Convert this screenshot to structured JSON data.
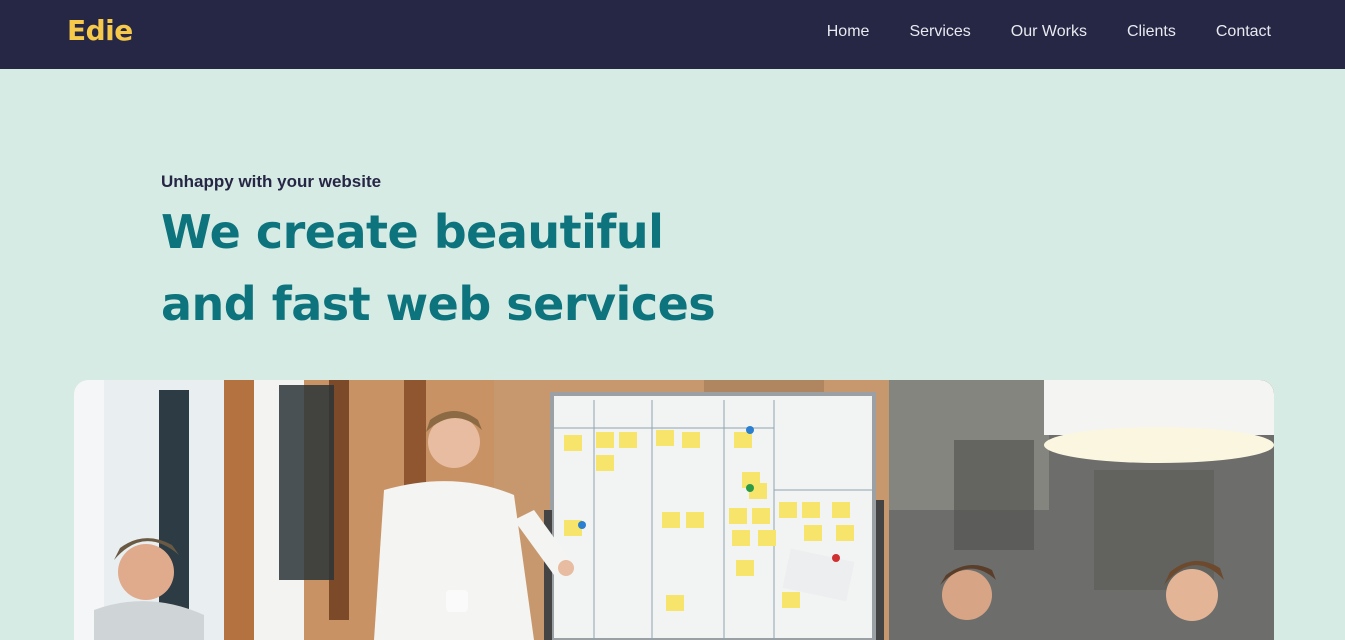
{
  "header": {
    "logo": "Edie",
    "nav": [
      "Home",
      "Services",
      "Our Works",
      "Clients",
      "Contact"
    ]
  },
  "hero": {
    "kicker": "Unhappy with your website",
    "title_line1": "We create beautiful",
    "title_line2": "and fast web services",
    "image_alt": "team-meeting-photo"
  },
  "colors": {
    "nav_bg": "#262645",
    "logo": "#f7c94a",
    "page_bg": "#d7ebe5",
    "title": "#0d737c",
    "kicker": "#262645"
  }
}
